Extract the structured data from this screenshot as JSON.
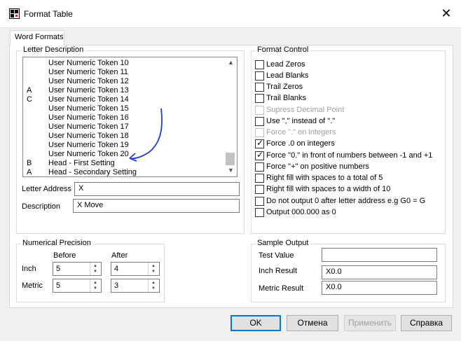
{
  "window": {
    "title": "Format Table",
    "close_glyph": "✕"
  },
  "tabs": [
    {
      "label": "Word Formats",
      "selected": true
    }
  ],
  "letter_description": {
    "group_label": "Letter Description",
    "rows": [
      {
        "code": "",
        "name": "User Numeric Token 10"
      },
      {
        "code": "",
        "name": "User Numeric Token 11"
      },
      {
        "code": "",
        "name": "User Numeric Token 12"
      },
      {
        "code": "A",
        "name": "User Numeric Token 13"
      },
      {
        "code": "C",
        "name": "User Numeric Token 14"
      },
      {
        "code": "",
        "name": "User Numeric Token 15"
      },
      {
        "code": "",
        "name": "User Numeric Token 16"
      },
      {
        "code": "",
        "name": "User Numeric Token 17"
      },
      {
        "code": "",
        "name": "User Numeric Token 18"
      },
      {
        "code": "",
        "name": "User Numeric Token 19"
      },
      {
        "code": "",
        "name": "User Numeric Token 20"
      },
      {
        "code": "B",
        "name": "Head - First Setting"
      },
      {
        "code": "A",
        "name": "Head - Secondary Setting"
      }
    ],
    "letter_address_label": "Letter Address",
    "letter_address_value": "X",
    "description_label": "Description",
    "description_value": "X Move"
  },
  "format_control": {
    "group_label": "Format Control",
    "options": [
      {
        "label": "Lead Zeros",
        "checked": false,
        "enabled": true
      },
      {
        "label": "Lead Blanks",
        "checked": false,
        "enabled": true
      },
      {
        "label": "Trail Zeros",
        "checked": false,
        "enabled": true
      },
      {
        "label": "Trail Blanks",
        "checked": false,
        "enabled": true
      },
      {
        "label": "Supress Decimal Point",
        "checked": false,
        "enabled": false
      },
      {
        "label": "Use \",\" instead of \".\"",
        "checked": false,
        "enabled": true
      },
      {
        "label": "Force \".\" on integers",
        "checked": false,
        "enabled": false
      },
      {
        "label": "Force .0 on integers",
        "checked": true,
        "enabled": true
      },
      {
        "label": "Force \"0.\" in front of numbers between -1 and +1",
        "checked": true,
        "enabled": true
      },
      {
        "label": "Force \"+\" on positive numbers",
        "checked": false,
        "enabled": true
      },
      {
        "label": "Right fill with spaces to a total of 5",
        "checked": false,
        "enabled": true
      },
      {
        "label": "Right fill with spaces to a width of 10",
        "checked": false,
        "enabled": true
      },
      {
        "label": "Do not output 0 after letter address e.g G0 = G",
        "checked": false,
        "enabled": true
      },
      {
        "label": "Output 000.000 as 0",
        "checked": false,
        "enabled": true
      }
    ],
    "check_glyph": "✓"
  },
  "numerical_precision": {
    "group_label": "Numerical Precision",
    "before_label": "Before",
    "after_label": "After",
    "inch_label": "Inch",
    "metric_label": "Metric",
    "inch_before": "5",
    "inch_after": "4",
    "metric_before": "5",
    "metric_after": "3"
  },
  "sample_output": {
    "group_label": "Sample Output",
    "test_value_label": "Test Value",
    "test_value": "",
    "inch_result_label": "Inch Result",
    "inch_result_value": "X0.0",
    "metric_result_label": "Metric Result",
    "metric_result_value": "X0.0"
  },
  "buttons": {
    "ok": "OK",
    "cancel": "Отмена",
    "apply": "Применить",
    "help": "Справка"
  },
  "colors": {
    "annotation_arrow": "#1a3fd4",
    "focus_border": "#0078d7"
  },
  "icons": {
    "app": "app-grid-icon",
    "scroll_up": "chevron-up-icon",
    "scroll_down": "chevron-down-icon"
  }
}
